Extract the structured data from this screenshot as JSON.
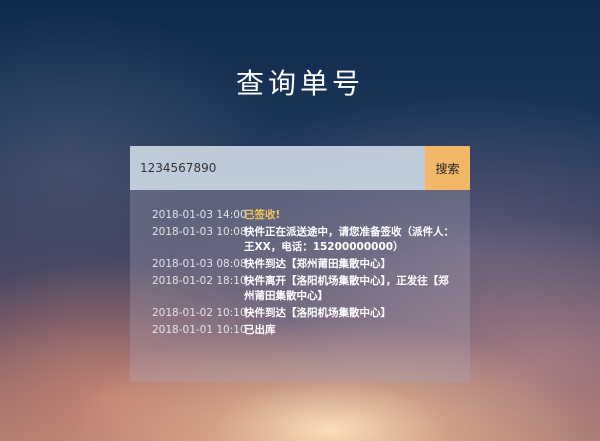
{
  "page": {
    "title": "查询单号"
  },
  "search": {
    "value": "1234567890",
    "placeholder": "",
    "button_label": "搜索"
  },
  "tracking": [
    {
      "time": "2018-01-03 14:00",
      "status": "已签收!",
      "highlight": true
    },
    {
      "time": "2018-01-03 10:08",
      "status": "快件正在派送途中，请您准备签收（派件人：王XX，电话：15200000000）",
      "highlight": false
    },
    {
      "time": "2018-01-03 08:08",
      "status": "快件到达【郑州莆田集散中心】",
      "highlight": false
    },
    {
      "time": "2018-01-02 18:10",
      "status": "快件离开【洛阳机场集散中心】，正发往【郑州莆田集散中心】",
      "highlight": false
    },
    {
      "time": "2018-01-02 10:10",
      "status": "快件到达【洛阳机场集散中心】",
      "highlight": false
    },
    {
      "time": "2018-01-01 10:10",
      "status": "已出库",
      "highlight": false
    }
  ],
  "colors": {
    "accent": "#f4b768",
    "signed_status": "#f2c25a"
  }
}
